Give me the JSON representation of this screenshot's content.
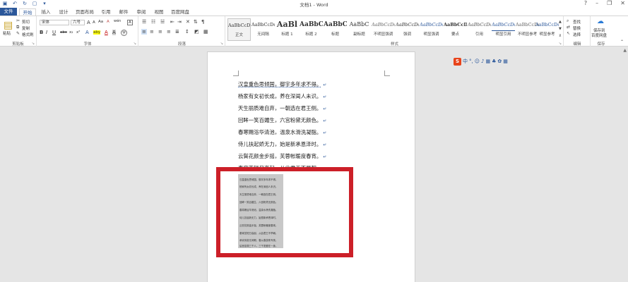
{
  "window": {
    "title": "文档1 - Word",
    "help": "?",
    "minimize": "–",
    "restore": "❐",
    "close": "✕"
  },
  "qat": {
    "save": "▣",
    "undo": "↶",
    "redo": "↻",
    "new": "▢",
    "more": "▾"
  },
  "tabs": [
    "文件",
    "开始",
    "插入",
    "设计",
    "页面布局",
    "引用",
    "邮件",
    "审阅",
    "视图",
    "百度网盘"
  ],
  "clipboard": {
    "paste": "粘贴",
    "cut": "剪切",
    "copy": "复制",
    "format_painter": "格式刷",
    "label": "剪贴板"
  },
  "font": {
    "family": "宋体",
    "size": "六号",
    "grow": "A",
    "shrink": "A",
    "case": "Aa",
    "clear": "A",
    "phonetic": "wén",
    "border": "A",
    "bold": "B",
    "italic": "I",
    "underline": "U",
    "strike": "abc",
    "sub": "x₂",
    "sup": "x²",
    "effects": "A",
    "highlight": "aby",
    "color": "A",
    "shading": "A",
    "enclose": "字",
    "label": "字体"
  },
  "paragraph": {
    "label": "段落"
  },
  "styles": {
    "label": "样式",
    "items": [
      {
        "preview": "AaBbCcDd",
        "name": "正文"
      },
      {
        "preview": "AaBbCcDd",
        "name": "无间隔"
      },
      {
        "preview": "AaBl",
        "name": "标题 1"
      },
      {
        "preview": "AaBbC",
        "name": "标题 2"
      },
      {
        "preview": "AaBbC",
        "name": "标题"
      },
      {
        "preview": "AaBbC",
        "name": "副标题"
      },
      {
        "preview": "AaBbCcDd",
        "name": "不明显强调"
      },
      {
        "preview": "AaBbCcDd",
        "name": "强调"
      },
      {
        "preview": "AaBbCcDd",
        "name": "明显强调"
      },
      {
        "preview": "AaBbCcDd",
        "name": "要点"
      },
      {
        "preview": "AaBbCcDd",
        "name": "引用"
      },
      {
        "preview": "AaBbCcDd",
        "name": "明显引用"
      },
      {
        "preview": "AaBbCcDd",
        "name": "不明显参考"
      },
      {
        "preview": "AaBbCcDd",
        "name": "明显参考"
      }
    ]
  },
  "editing": {
    "find": "查找",
    "replace": "替换",
    "select": "选择",
    "label": "编辑"
  },
  "save_group": {
    "btn1": "保存到",
    "btn2": "百度网盘",
    "label": "保存"
  },
  "ime": {
    "logo": "S",
    "items": [
      "中",
      "°,",
      "☺",
      "♪",
      "▦",
      "♣",
      "✿",
      "▦"
    ]
  },
  "document": {
    "lines": [
      "汉皇重色思倾国，御宇多年求不得。",
      "杨家有女初长成，养在深闺人未识。",
      "天生丽质难自弃，一朝选在君王侧。",
      "回眸一笑百媚生，六宫粉黛无颜色。",
      "春寒赐浴华清池，温泉水滑洗凝脂。",
      "侍儿扶起娇无力，始是新承恩泽时。",
      "云鬓花颜金步摇，芙蓉帐暖度春宵。",
      "春宵苦短日高起，从此君王不早朝。"
    ],
    "para_mark": "↵",
    "thumbnail_lines": [
      "汉皇重色思倾国，御宇多年求不得。",
      "杨家有女初长成，养在深闺人未识。",
      "天生丽质难自弃，一朝选在君王侧。",
      "回眸一笑百媚生，六宫粉黛无颜色。",
      "春寒赐浴华清池，温泉水滑洗凝脂。",
      "侍儿扶起娇无力，始是新承恩泽时。",
      "云鬓花颜金步摇，芙蓉帐暖度春宵。",
      "春宵苦短日高起，从此君王不早朝。",
      "承欢侍宴无闲暇，春从春游夜专夜。",
      "后宫佳丽三千人，三千宠爱在一身。"
    ]
  },
  "colors": {
    "accent": "#2b579a",
    "highlight_box": "#cc1f28"
  }
}
